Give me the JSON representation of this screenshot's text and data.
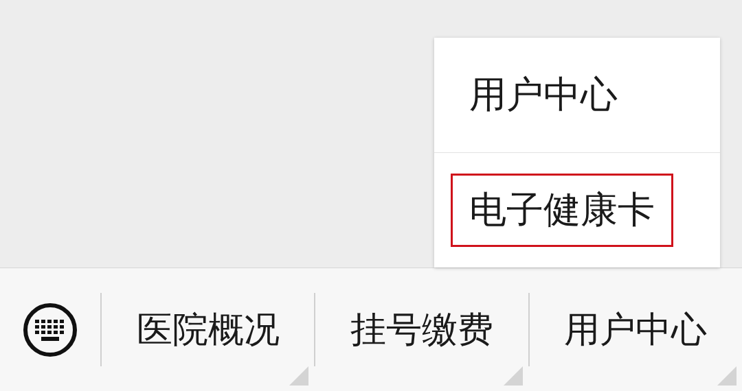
{
  "popup_menu": {
    "items": [
      {
        "label": "用户中心",
        "highlighted": false
      },
      {
        "label": "电子健康卡",
        "highlighted": true
      }
    ]
  },
  "menu_bar": {
    "items": [
      {
        "label": "医院概况",
        "has_submenu": true
      },
      {
        "label": "挂号缴费",
        "has_submenu": true
      },
      {
        "label": "用户中心",
        "has_submenu": true
      }
    ]
  }
}
